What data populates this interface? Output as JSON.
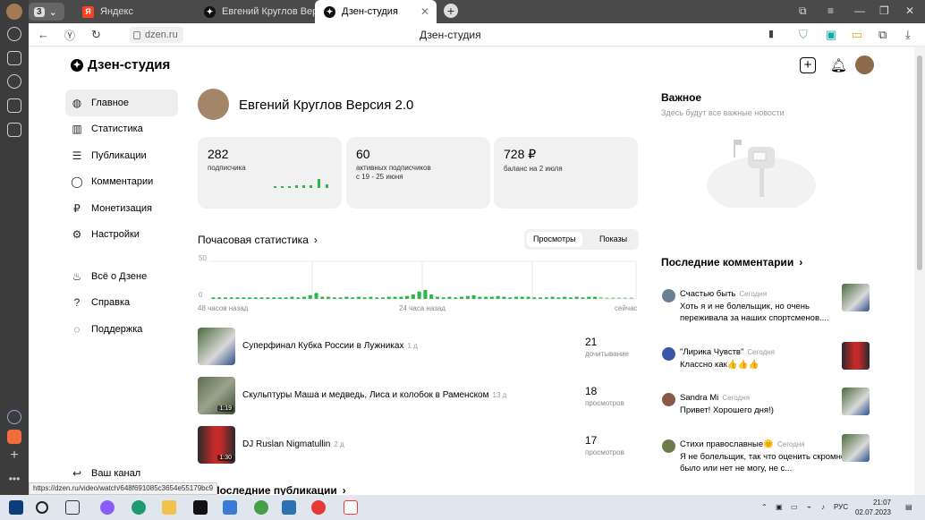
{
  "browser": {
    "tab_count": "3",
    "tabs": [
      {
        "label": "Яндекс"
      },
      {
        "label": "Евгений Круглов Версия ..."
      },
      {
        "label": "Дзен-студия"
      }
    ],
    "url": "dzen.ru",
    "page_title": "Дзен-студия",
    "status_url": "https://dzen.ru/video/watch/648f691085c3654e55179bc9"
  },
  "logo": {
    "text": "Дзен-студия"
  },
  "nav": {
    "items": [
      {
        "label": "Главное",
        "icon": "planet-icon"
      },
      {
        "label": "Статистика",
        "icon": "bar-chart-icon"
      },
      {
        "label": "Публикации",
        "icon": "stack-icon"
      },
      {
        "label": "Комментарии",
        "icon": "speech-bubble-icon"
      },
      {
        "label": "Монетизация",
        "icon": "ruble-icon"
      },
      {
        "label": "Настройки",
        "icon": "gear-icon"
      }
    ],
    "secondary": [
      {
        "label": "Всё о Дзене",
        "icon": "flame-icon"
      },
      {
        "label": "Справка",
        "icon": "question-icon"
      },
      {
        "label": "Поддержка",
        "icon": "support-icon"
      }
    ],
    "channel_link": "Ваш канал"
  },
  "channel": {
    "name": "Евгений Круглов Версия 2.0"
  },
  "stats": [
    {
      "value": "282",
      "label": "подписчика"
    },
    {
      "value": "60",
      "label": "активных подписчиков",
      "sub": "с 19 - 25 июня"
    },
    {
      "value": "728 ₽",
      "label": "баланс на 2 июля"
    }
  ],
  "hourly": {
    "title": "Почасовая статистика",
    "tab_views": "Просмотры",
    "tab_shows": "Показы",
    "y_max": "50",
    "y_min": "0",
    "x_labels": [
      "48 часов назад",
      "24 часа назад",
      "сейчас"
    ]
  },
  "chart_data": {
    "type": "bar",
    "title": "Почасовая статистика",
    "ylim": [
      0,
      50
    ],
    "values": [
      2,
      2,
      2,
      2,
      2,
      2,
      2,
      2,
      2,
      2,
      2,
      2,
      2,
      3,
      2,
      3,
      5,
      8,
      3,
      3,
      2,
      2,
      3,
      2,
      3,
      2,
      3,
      2,
      2,
      3,
      3,
      3,
      4,
      6,
      10,
      12,
      6,
      3,
      2,
      3,
      2,
      3,
      4,
      5,
      3,
      3,
      3,
      4,
      3,
      2,
      3,
      3,
      3,
      2,
      2,
      2,
      3,
      2,
      3,
      2,
      3,
      2,
      3,
      3,
      3,
      2,
      2,
      2,
      2,
      2
    ]
  },
  "publications": [
    {
      "title": "Суперфинал Кубка России в Лужниках",
      "age": "1 д",
      "count": "21",
      "metric": "дочитывание",
      "duration": ""
    },
    {
      "title": "Скульптуры Маша и медведь, Лиса и колобок в Раменском",
      "age": "13 д",
      "count": "18",
      "metric": "просмотров",
      "duration": "1:19"
    },
    {
      "title": "DJ Ruslan Nigmatullin",
      "age": "2 д",
      "count": "17",
      "metric": "просмотров",
      "duration": "1:30"
    }
  ],
  "last_publications": {
    "title": "Последние публикации"
  },
  "important": {
    "title": "Важное",
    "subtitle": "Здесь будут все важные новости"
  },
  "comments": {
    "title": "Последние комментарии",
    "items": [
      {
        "author": "Счастью быть",
        "when": "Сегодня",
        "text": "Хоть я и не болельщик, но очень переживала за наших спортсменов....",
        "avatar_color": "#6b7f92"
      },
      {
        "author": "\"Лирика Чувств\"",
        "when": "Сегодня",
        "text": "Классно как👍👍👍",
        "avatar_color": "#3b56a8"
      },
      {
        "author": "Sandra Mi",
        "when": "Сегодня",
        "text": "Привет! Хорошего дня!)",
        "avatar_color": "#8a5a44"
      },
      {
        "author": "Стихи православные🌞",
        "when": "Сегодня",
        "text": "Я не болельщик, так что оценить скромно было или нет не могу, не с...",
        "avatar_color": "#6d7a4c"
      }
    ]
  },
  "taskbar": {
    "lang": "РУС",
    "time": "21:07",
    "date": "02.07.2023"
  },
  "colors": {
    "accent_green": "#2fb54a",
    "card_bg": "#f1f1f1",
    "nav_active": "#eeeeee"
  }
}
